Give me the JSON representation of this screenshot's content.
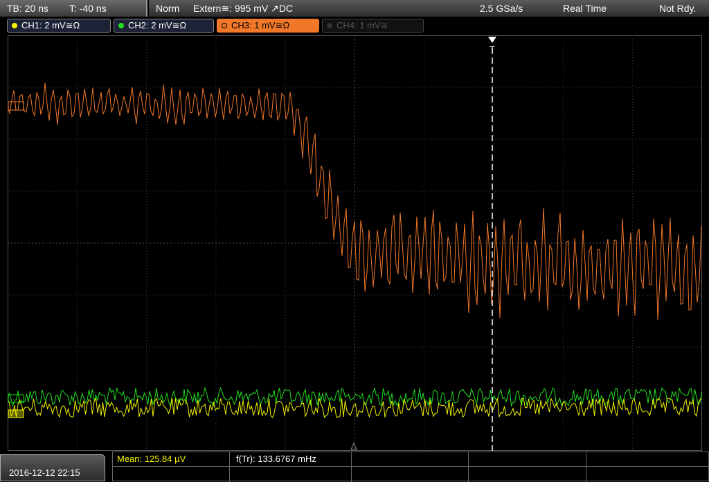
{
  "status_bar": {
    "timebase": "TB: 20 ns",
    "trigger_time": "T: -40 ns",
    "trigger_mode": "Norm",
    "trigger_source": "Extern≅: 995 mV ↗DC",
    "sample_rate": "2.5 GSa/s",
    "acq_mode": "Real Time",
    "acq_state": "Not Rdy."
  },
  "channels": [
    {
      "label": "CH1: 2 mV≅Ω",
      "color": "#f5f500",
      "active": true
    },
    {
      "label": "CH2: 2 mV≅Ω",
      "color": "#20e020",
      "active": true
    },
    {
      "label": "CH3: 1 mV≅Ω",
      "color": "#f07828",
      "active": true,
      "selected": true
    },
    {
      "label": "CH4: 1 mV≅",
      "color": "#555555",
      "active": false
    }
  ],
  "trigger_marker": "T",
  "measurements": {
    "mean": "Mean: 125.84 µV",
    "frequency": "f(Tr): 133.6767 mHz"
  },
  "timestamp": "2016-12-12 22:15",
  "colors": {
    "ch1": "#f5f500",
    "ch2": "#20e020",
    "ch3": "#f07828",
    "grid": "#3a3a3a",
    "cursor": "#ffffff"
  }
}
